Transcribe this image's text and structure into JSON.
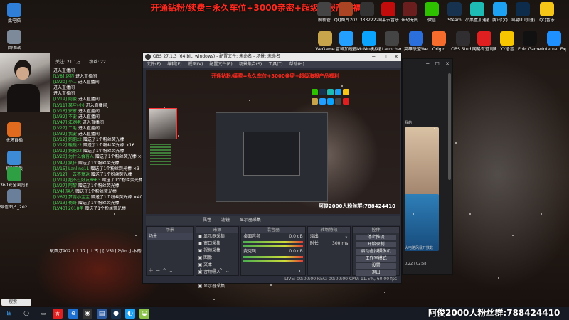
{
  "banner": {
    "text": "开通钻粉/续费=永久车位+3000亲密+超级海报产品福利"
  },
  "left_icons": [
    {
      "label": "此电脑",
      "icon": "computer-icon",
      "color": "#2f7fd8"
    },
    {
      "label": "回收站",
      "icon": "recycle-bin-icon",
      "color": "#7c8a99"
    },
    {
      "label": "虎牙直播",
      "icon": "huya-icon",
      "color": "#e06b1f"
    },
    {
      "label": "控制面板",
      "icon": "control-panel-icon",
      "color": "#3d8ad6"
    },
    {
      "label": "360安全浏览器",
      "icon": "browser-360-icon",
      "color": "#2ea043"
    },
    {
      "label": "微信图片_2022062...",
      "icon": "image-file-icon",
      "color": "#6a7f9a"
    }
  ],
  "top_icons": [
    {
      "label": "微信",
      "icon": "wechat-icon",
      "color": "#2dc100"
    },
    {
      "label": "Steam",
      "icon": "steam-icon",
      "color": "#17324f"
    },
    {
      "label": "小黑盒加速器",
      "icon": "heybox-icon",
      "color": "#1dbbb3"
    },
    {
      "label": "腾讯QQ",
      "icon": "qq-icon",
      "color": "#1da1f2"
    },
    {
      "label": "网易UU加速器",
      "icon": "uu-icon",
      "color": "#0d2b4a"
    },
    {
      "label": "QQ音乐",
      "icon": "qq-music-icon",
      "color": "#f5c518"
    },
    {
      "label": "WeGame",
      "icon": "wegame-icon",
      "color": "#c8a54a"
    },
    {
      "label": "雷神加速器",
      "icon": "leishen-icon",
      "color": "#23a0ff"
    },
    {
      "label": "MuMu模拟器",
      "icon": "mumu-icon",
      "color": "#0aa4ff"
    },
    {
      "label": "Launcher",
      "icon": "launcher-icon",
      "color": "#444444"
    },
    {
      "label": "英雄联盟WeGame版",
      "icon": "lol-icon",
      "color": "#2a6fdb"
    },
    {
      "label": "Origin",
      "icon": "origin-icon",
      "color": "#f56c2d"
    },
    {
      "label": "OBS Studio",
      "icon": "obs-icon",
      "color": "#302e31"
    },
    {
      "label": "网易有道词典",
      "icon": "youdao-icon",
      "color": "#e02020"
    },
    {
      "label": "YY语音",
      "icon": "yy-icon",
      "color": "#f7c600"
    },
    {
      "label": "Epic Games Launcher",
      "icon": "epic-icon",
      "color": "#111111"
    },
    {
      "label": "Internet Explorer",
      "icon": "ie-icon",
      "color": "#1e90ff"
    }
  ],
  "top_row_icons": [
    {
      "label": "刷新管",
      "icon": "app-icon",
      "color": "#444444"
    },
    {
      "label": "QQ图片20211223...",
      "icon": "image-file-icon",
      "color": "#aa4422"
    },
    {
      "label": "...3332222...",
      "icon": "image-file-icon",
      "color": "#333333"
    },
    {
      "label": "网易云音乐",
      "icon": "netease-music-icon",
      "color": "#c20c0c"
    },
    {
      "label": "永劫无间",
      "icon": "naraka-icon",
      "color": "#6b1e1e"
    }
  ],
  "stats": {
    "items": [
      "关注: 21.1万",
      "粉丝: 22"
    ]
  },
  "chat": [
    {
      "user": "",
      "msg": "进入直播间"
    },
    {
      "user": "[LV8] 迷你",
      "msg": "进入直播间"
    },
    {
      "user": "[LV20] 小...",
      "msg": "进入直播间"
    },
    {
      "user": "",
      "msg": "进入直播间"
    },
    {
      "user": "",
      "msg": "进入直播间"
    },
    {
      "user": "[LV19] 阿俊",
      "msg": "进入直播间"
    },
    {
      "user": "[LV11] 某些(小)",
      "msg": "进入直播间"
    },
    {
      "user": "[LV16] 安慰",
      "msg": "进入直播间"
    },
    {
      "user": "[LV32] 不要",
      "msg": "进入直播间"
    },
    {
      "user": "[LV47] 江湖老",
      "msg": "进入直播间"
    },
    {
      "user": "[LV27] 二毛",
      "msg": "进入直播间"
    },
    {
      "user": "[LV32] 我要",
      "msg": "进入直播间"
    },
    {
      "user": "[LV12] 鹅鹅z2",
      "msg": "赠送了1个粉丝荧光棒"
    },
    {
      "user": "[LV12] 暖暖z2",
      "msg": "赠送了1个粉丝荧光棒 ×16"
    },
    {
      "user": "[LV12] 鹅鹅z2",
      "msg": "赠送了1个粉丝荧光棒"
    },
    {
      "user": "[LV20] 为什么会有人",
      "msg": "赠送了1个粉丝荧光棒 ×40"
    },
    {
      "user": "[LV47] 疯狂",
      "msg": "赠送了1个粉丝荧光棒"
    },
    {
      "user": "[LV15] Lanling11",
      "msg": "赠送了1个粉丝荧光棒 ×3"
    },
    {
      "user": "[LV12] 一去不复返",
      "msg": "赠送了1个粉丝荧光棒"
    },
    {
      "user": "[LV19] 超不过好友8663",
      "msg": "赠送了1个粉丝荧光棒"
    },
    {
      "user": "[LV27] 阿黎",
      "msg": "赠送了1个粉丝荧光棒"
    },
    {
      "user": "[LV4] 旗人",
      "msg": "赠送了1个粉丝荧光棒"
    },
    {
      "user": "[LV67] 梦露小宝宝",
      "msg": "赠送了1个粉丝荧光棒 ×40"
    },
    {
      "user": "[LV13] 杨哥",
      "msg": "赠送了1个粉丝荧光棒"
    },
    {
      "user": "[LV43] 2018年",
      "msg": "赠送了1个粉丝荧光棒"
    }
  ],
  "chat_tail": "氧酉汀902 1 1 17 | 上古 | [LV51] 沽1n 小木的开朗  赠送了1个粉丝荧光棒",
  "obs": {
    "title": "OBS 27.1.3 (64 bit, windows) - 配置文件: 未命名 - 场景: 未命名",
    "menu": [
      "文件(F)",
      "编辑(E)",
      "视图(V)",
      "配置文件(P)",
      "场景集合(S)",
      "工具(T)",
      "帮助(H)"
    ],
    "preview_group": "阿俊2000人粉丝群:788424410",
    "ctrl": [
      "属性",
      "滤镜",
      "显示器采集"
    ],
    "docks": {
      "scenes_title": "场景",
      "scene_item": "场景",
      "sources_title": "来源",
      "sources": [
        "显示器采集",
        "窗口采集",
        "视频采集",
        "图像",
        "文本",
        "音频输入",
        "浏览器",
        "显示器采集"
      ],
      "mixer_title": "混音器",
      "mixer": [
        {
          "name": "桌面音频",
          "db": "0.0 dB"
        },
        {
          "name": "麦克风",
          "db": "0.0 dB"
        }
      ],
      "transition_title": "转场特效",
      "transition_value": "淡出",
      "duration_label": "时长",
      "duration_value": "300 ms",
      "controls_title": "控件",
      "controls": [
        "停止推流",
        "开始录制",
        "启动虚拟摄像机",
        "工作室模式",
        "设置",
        "退出"
      ]
    },
    "status": "LIVE: 00:00:00   REC: 00:00:00   CPU: 11.5%, 60.00 fps"
  },
  "browser": {
    "caption1": "我的",
    "caption2": "大电路风暴开数数",
    "caption3": "0.22 / 02:58"
  },
  "group_text": "阿俊2000人粉丝群:788424410",
  "taskbar": {
    "search_text": "搜索"
  }
}
